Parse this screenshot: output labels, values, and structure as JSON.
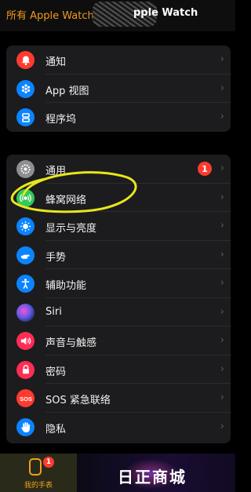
{
  "topbar": {
    "back_label": "所有 Apple Watch",
    "title": "pple Watch"
  },
  "groups": [
    {
      "items": [
        {
          "label": "通知",
          "icon": "bell-icon",
          "color": "#ff3b30"
        },
        {
          "label": "App 视图",
          "icon": "app-grid-icon",
          "color": "#0a84ff"
        },
        {
          "label": "程序坞",
          "icon": "dock-icon",
          "color": "#0a84ff"
        }
      ]
    },
    {
      "items": [
        {
          "label": "通用",
          "icon": "gear-icon",
          "color": "#8e8e93",
          "badge": "1"
        },
        {
          "label": "蜂窝网络",
          "icon": "cellular-icon",
          "color": "#34c759"
        },
        {
          "label": "显示与亮度",
          "icon": "sun-icon",
          "color": "#0a84ff"
        },
        {
          "label": "手势",
          "icon": "hand-gesture-icon",
          "color": "#0a84ff"
        },
        {
          "label": "辅助功能",
          "icon": "accessibility-icon",
          "color": "#0a84ff"
        },
        {
          "label": "Siri",
          "icon": "siri-icon",
          "color": "#5e5ce6"
        },
        {
          "label": "声音与触感",
          "icon": "speaker-icon",
          "color": "#ff2d55"
        },
        {
          "label": "密码",
          "icon": "lock-icon",
          "color": "#ff2d55"
        },
        {
          "label": "SOS 紧急联络",
          "icon": "sos-icon",
          "color": "#ff3b30"
        },
        {
          "label": "隐私",
          "icon": "privacy-hand-icon",
          "color": "#0a84ff"
        }
      ]
    }
  ],
  "tabbar": {
    "my_watch_label": "我的手表",
    "my_watch_badge": "1"
  },
  "watermark": {
    "text": "日正商城"
  },
  "colors": {
    "accent": "#f39a1b",
    "annotation": "#e8e61c"
  }
}
